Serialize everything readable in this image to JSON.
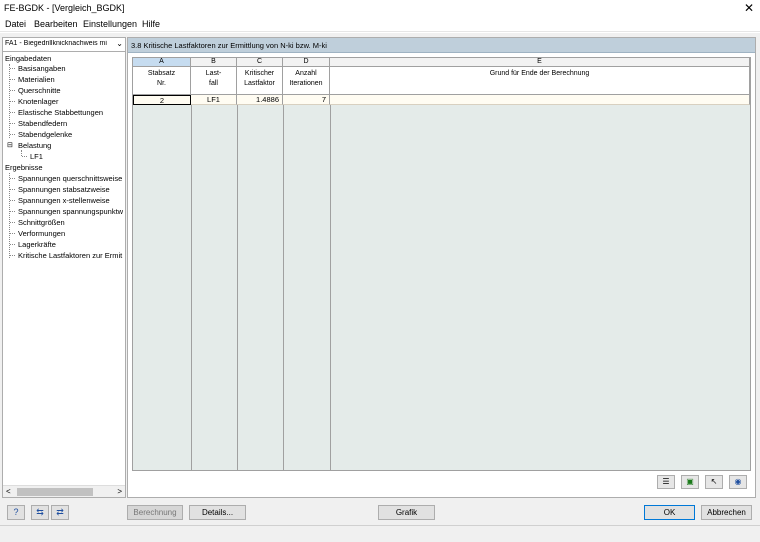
{
  "window": {
    "title": "FE-BGDK - [Vergleich_BGDK]",
    "close_glyph": "✕"
  },
  "menu": {
    "items": [
      "Datei",
      "Bearbeiten",
      "Einstellungen",
      "Hilfe"
    ]
  },
  "case_selector": {
    "value": "FA1 - Biegedrillknicknachweis mi"
  },
  "tree": {
    "input_group": "Eingabedaten",
    "input_items": [
      "Basisangaben",
      "Materialien",
      "Querschnitte",
      "Knotenlager",
      "Elastische Stabbettungen",
      "Stabendfedern",
      "Stabendgelenke"
    ],
    "loads_group": "Belastung",
    "load_cases": [
      "LF1"
    ],
    "results_group": "Ergebnisse",
    "result_items": [
      "Spannungen querschnittsweise",
      "Spannungen stabsatzweise",
      "Spannungen x-stellenweise",
      "Spannungen spannungspunktw",
      "Schnittgrößen",
      "Verformungen",
      "Lagerkräfte",
      "Kritische Lastfaktoren zur Ermit"
    ]
  },
  "panel": {
    "title": "3.8 Kritische Lastfaktoren zur Ermittlung von N-ki bzw. M-ki"
  },
  "table": {
    "column_letters": [
      "A",
      "B",
      "C",
      "D",
      "E"
    ],
    "headers": [
      [
        "Stabsatz",
        "Nr."
      ],
      [
        "Last-",
        "fall"
      ],
      [
        "Kritischer",
        "Lastfaktor"
      ],
      [
        "Anzahl",
        "Iterationen"
      ],
      [
        "",
        "Grund für Ende der Berechnung"
      ]
    ],
    "rows": [
      [
        "2",
        "LF1",
        "1.4886",
        "7",
        ""
      ]
    ]
  },
  "buttons": {
    "berechnung": "Berechnung",
    "details": "Details...",
    "grafik": "Grafik",
    "ok": "OK",
    "abbrechen": "Abbrechen"
  },
  "icons": {
    "help": "?",
    "export": "⇆",
    "import": "⇄",
    "grid_tool_1": "☰",
    "grid_tool_2": "▣",
    "grid_tool_3": "↖",
    "grid_tool_4": "◉"
  },
  "colors": {
    "panel_header": "#bfcfdb",
    "grid_bg": "#e4ebe9",
    "row_bg": "#fffcf2"
  }
}
